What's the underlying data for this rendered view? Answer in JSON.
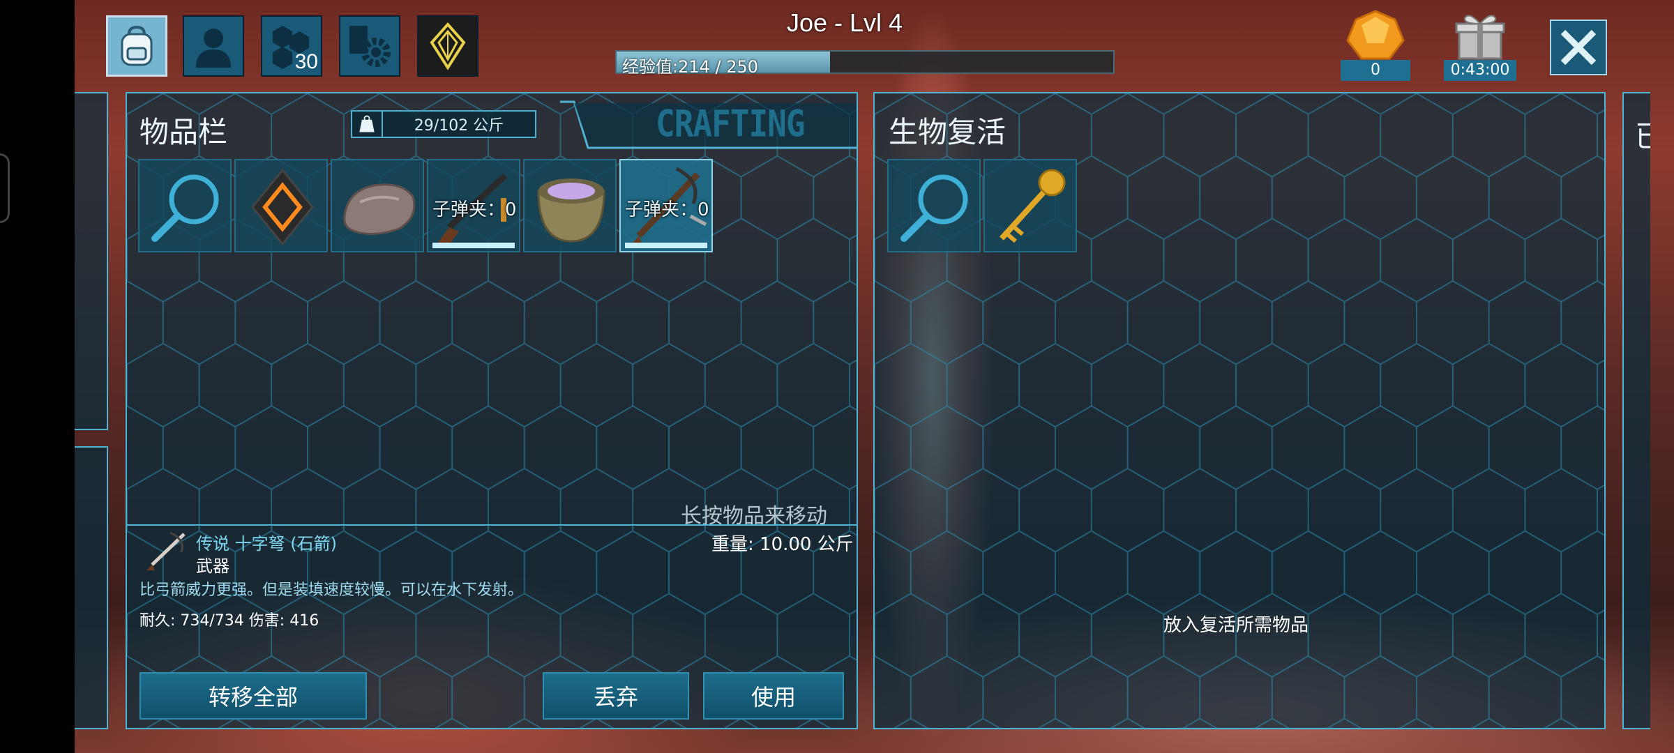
{
  "header": {
    "player_name": "Joe - Lvl 4",
    "xp_label": "经验值:214 / 250",
    "xp_progress": 0.43,
    "engram_points": "30",
    "amber_count": "0",
    "gift_timer": "0:43:00"
  },
  "top_tabs": [
    {
      "name": "inventory",
      "icon": "backpack-icon",
      "active": true
    },
    {
      "name": "character",
      "icon": "person-icon",
      "active": false
    },
    {
      "name": "engrams",
      "icon": "hexagons-icon",
      "active": false
    },
    {
      "name": "settings",
      "icon": "gear-icon",
      "active": false
    },
    {
      "name": "crystal",
      "icon": "crystal-icon",
      "active": false
    }
  ],
  "inventory": {
    "title": "物品栏",
    "weight": "29/102 公斤",
    "crafting_tab": "CRAFTING",
    "hint": "长按物品来移动",
    "items": [
      {
        "icon": "search-icon",
        "ammo": ""
      },
      {
        "icon": "implant-icon",
        "ammo": ""
      },
      {
        "icon": "stone-icon",
        "ammo": ""
      },
      {
        "icon": "rifle-icon",
        "ammo": "子弹夹：0"
      },
      {
        "icon": "mortar-pestle-icon",
        "ammo": ""
      },
      {
        "icon": "crossbow-icon",
        "ammo": "子弹夹：0"
      }
    ]
  },
  "selected_item": {
    "name": "传说 十字弩 (石箭)",
    "type": "武器",
    "weight": "重量: 10.00 公斤",
    "description": "比弓箭威力更强。但是装填速度较慢。可以在水下发射。",
    "stats": "耐久: 734/734  伤害: 416"
  },
  "actions": {
    "transfer_all": "转移全部",
    "drop": "丢弃",
    "use": "使用"
  },
  "revive": {
    "title": "生物复活",
    "drop_hint": "放入复活所需物品",
    "items": [
      {
        "icon": "search-icon"
      },
      {
        "icon": "skull-key-icon"
      }
    ]
  },
  "right_edge_title": "已",
  "colors": {
    "accent": "#4fb3d4",
    "panel_bg": "#082d3c",
    "name_color": "#7fd6f0"
  }
}
